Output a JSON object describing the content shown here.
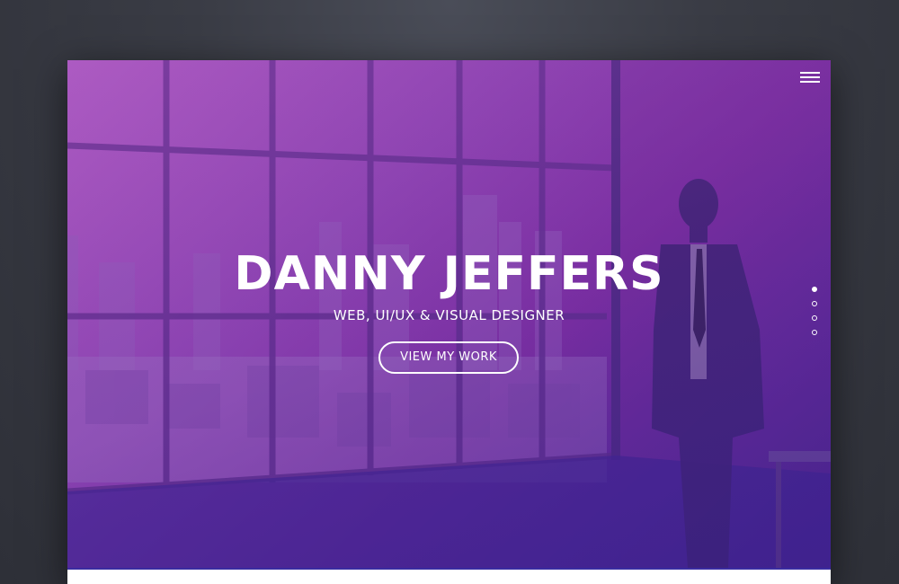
{
  "hero": {
    "name": "DANNY JEFFERS",
    "tagline": "WEB, UI/UX & VISUAL DESIGNER",
    "cta_label": "VIEW MY WORK"
  },
  "nav": {
    "menu_icon": "hamburger-menu-icon",
    "slide_count": 4,
    "active_slide": 1
  },
  "colors": {
    "gradient_start": "#a75bc0",
    "gradient_mid": "#7a2fa0",
    "gradient_end": "#3d2488",
    "text": "#ffffff"
  }
}
